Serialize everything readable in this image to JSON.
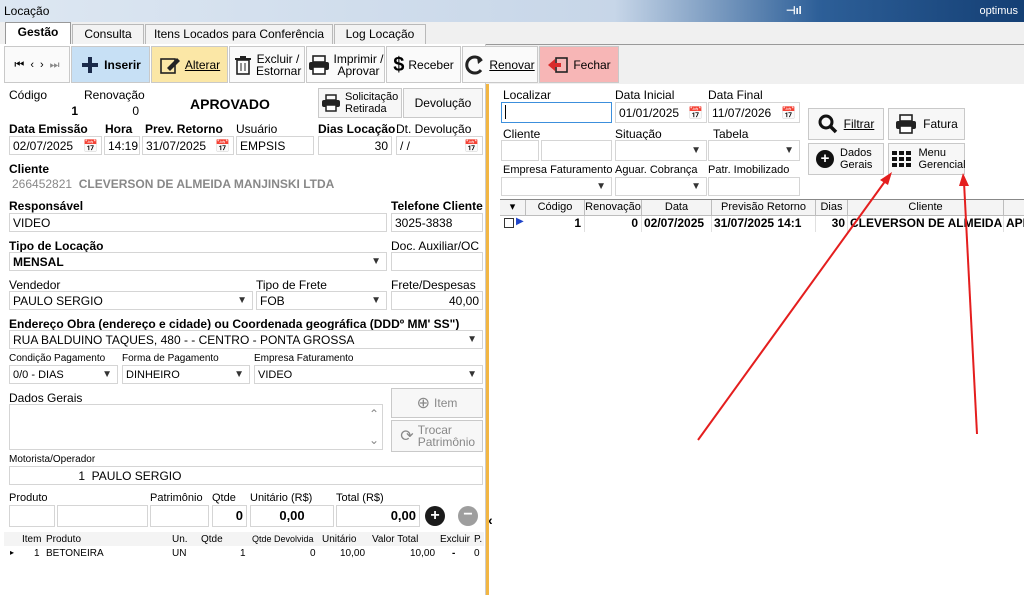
{
  "window": {
    "title": "Locação",
    "user": "optimus"
  },
  "tabs": [
    {
      "label": "Gestão"
    },
    {
      "label": "Consulta"
    },
    {
      "label": "Itens Locados para Conferência"
    },
    {
      "label": "Log Locação"
    }
  ],
  "toolbar": {
    "insert": "Inserir",
    "edit": "Alterar",
    "delete": "Excluir / Estornar",
    "print": "Imprimir / Aprovar",
    "receive": "Receber",
    "renew": "Renovar",
    "close": "Fechar"
  },
  "form": {
    "codigo_label": "Código",
    "codigo": "1",
    "renovacao_label": "Renovação",
    "renovacao": "0",
    "status": "APROVADO",
    "solicitacao": "Solicitação Retirada",
    "devolucao": "Devolução",
    "emissao_label": "Data Emissão",
    "emissao": "02/07/2025",
    "hora_label": "Hora",
    "hora": "14:19:",
    "prev_retorno_label": "Prev. Retorno",
    "prev_retorno": "31/07/2025",
    "usuario_label": "Usuário",
    "usuario": "EMPSIS",
    "dias_label": "Dias Locação",
    "dias": "30",
    "dt_devolucao_label": "Dt. Devolução",
    "dt_devolucao": " /  /",
    "cliente_label": "Cliente",
    "cliente_codigo": "266452821",
    "cliente_nome": "CLEVERSON DE ALMEIDA MANJINSKI LTDA",
    "responsavel_label": "Responsável",
    "responsavel": "VIDEO",
    "telefone_label": "Telefone Cliente",
    "telefone": "3025-3838",
    "tipo_locacao_label": "Tipo de Locação",
    "tipo_locacao": "MENSAL",
    "doc_aux_label": "Doc. Auxiliar/OC",
    "doc_aux": "",
    "vendedor_label": "Vendedor",
    "vendedor": "PAULO SERGIO",
    "tipo_frete_label": "Tipo de Frete",
    "tipo_frete": "FOB",
    "frete_label": "Frete/Despesas",
    "frete": "40,00",
    "endereco_label": "Endereço Obra (endereço e cidade) ou Coordenada geográfica (DDDº MM' SS\")",
    "endereco": "RUA BALDUINO TAQUES, 480 -  - CENTRO - PONTA GROSSA",
    "cond_pag_label": "Condição Pagamento",
    "cond_pag": "0/0 - DIAS",
    "forma_pag_label": "Forma de Pagamento",
    "forma_pag": "DINHEIRO",
    "empresa_fat_label": "Empresa Faturamento",
    "empresa_fat": "VIDEO",
    "dados_gerais_label": "Dados Gerais",
    "item_btn": "Item",
    "trocar_btn": "Trocar Patrimônio",
    "motorista_label": "Motorista/Operador",
    "motorista_codigo": "1",
    "motorista_nome": "PAULO SERGIO",
    "produto_label": "Produto",
    "patrimonio_label": "Patrimônio",
    "qtde_label": "Qtde",
    "unitario_label": "Unitário (R$)",
    "total_label": "Total (R$)",
    "qtde": "0",
    "unitario": "0,00",
    "total": "0,00"
  },
  "items_grid": {
    "headers": [
      "Item",
      "Produto",
      "Un.",
      "Qtde",
      "Qtde Devolvida",
      "Unitário",
      "Valor Total",
      "Excluir",
      "P."
    ],
    "row": [
      "1",
      "BETONEIRA",
      "UN",
      "1",
      "0",
      "10,00",
      "10,00",
      "-",
      "0"
    ]
  },
  "filters": {
    "localizar_label": "Localizar",
    "localizar": "",
    "data_inicial_label": "Data Inicial",
    "data_inicial": "01/01/2025",
    "data_final_label": "Data Final",
    "data_final": "11/07/2026",
    "cliente_label": "Cliente",
    "situacao_label": "Situação",
    "tabela_label": "Tabela",
    "empresa_fat_label": "Empresa Faturamento",
    "aguar_label": "Aguar. Cobrança",
    "patr_label": "Patr. Imobilizado",
    "filtrar": "Filtrar",
    "fatura": "Fatura",
    "dados_gerais": "Dados Gerais",
    "menu_gerencial": "Menu Gerencial"
  },
  "results_grid": {
    "headers": [
      "Código",
      "Renovação",
      "Data",
      "Previsão Retorno",
      "Dias",
      "Cliente"
    ],
    "row": [
      "1",
      "0",
      "02/07/2025",
      "31/07/2025 14:1",
      "30",
      "CLEVERSON DE ALMEIDA M",
      "APP"
    ]
  },
  "colors": {
    "insert_bg": "#c7e0f5",
    "edit_bg": "#fbe7a6",
    "close_bg": "#f7b6b6",
    "annotation": "#e41e1e"
  }
}
